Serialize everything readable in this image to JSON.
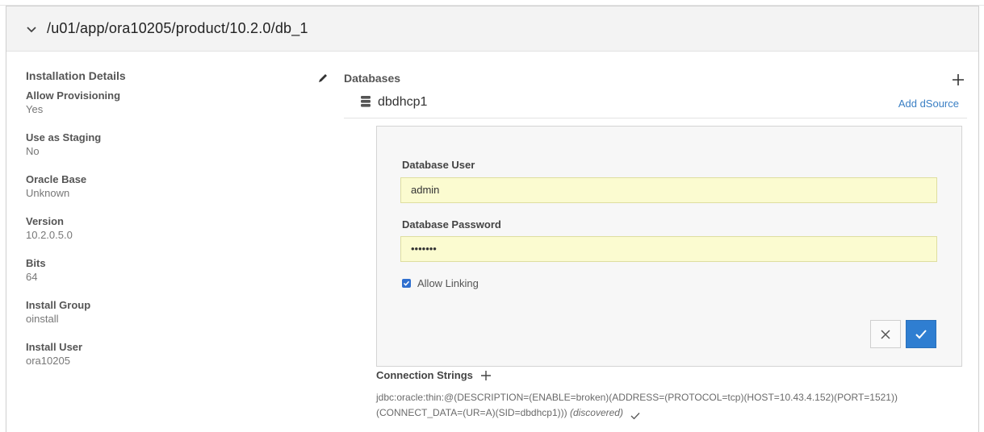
{
  "header": {
    "path": "/u01/app/ora10205/product/10.2.0/db_1"
  },
  "installation": {
    "title": "Installation Details",
    "fields": [
      {
        "label": "Allow Provisioning",
        "value": "Yes"
      },
      {
        "label": "Use as Staging",
        "value": "No"
      },
      {
        "label": "Oracle Base",
        "value": "Unknown"
      },
      {
        "label": "Version",
        "value": "10.2.0.5.0"
      },
      {
        "label": "Bits",
        "value": "64"
      },
      {
        "label": "Install Group",
        "value": "oinstall"
      },
      {
        "label": "Install User",
        "value": "ora10205"
      }
    ]
  },
  "databases": {
    "title": "Databases",
    "db_name": "dbdhcp1",
    "add_dsource": "Add dSource",
    "form": {
      "user_label": "Database User",
      "user_value": "admin",
      "password_label": "Database Password",
      "password_value": "•••••••",
      "allow_linking_label": "Allow Linking",
      "allow_linking_checked": true
    }
  },
  "connection": {
    "title": "Connection Strings",
    "line1": "jdbc:oracle:thin:@(DESCRIPTION=(ENABLE=broken)(ADDRESS=(PROTOCOL=tcp)(HOST=10.43.4.152)(PORT=1521))",
    "line2": "(CONNECT_DATA=(UR=A)(SID=dbdhcp1)))",
    "status": "(discovered)"
  },
  "colors": {
    "accent": "#2f7ed1",
    "link": "#3a7fc4",
    "input_bg": "#fbfbd0"
  }
}
